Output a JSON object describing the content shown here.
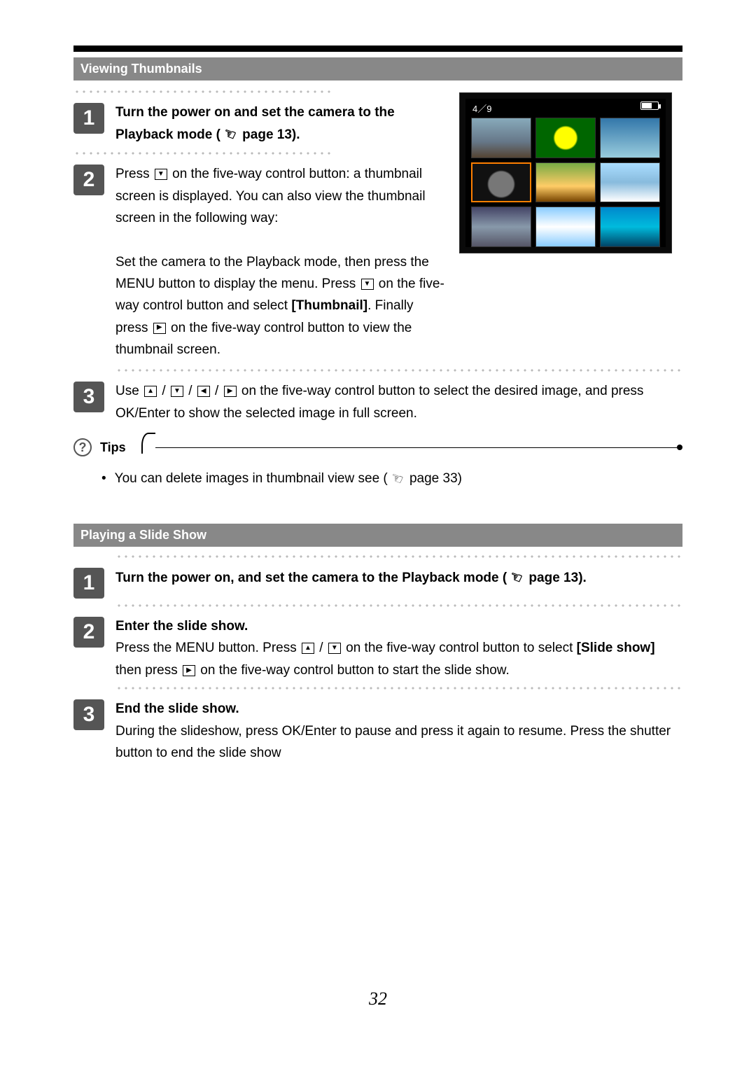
{
  "section1": {
    "title": "Viewing Thumbnails",
    "step1": {
      "num": "1",
      "bold_a": "Turn the power on and set the camera to the Playback mode (",
      "page_ref": "  page 13)."
    },
    "step2": {
      "num": "2",
      "p1_a": "Press ",
      "p1_b": " on the five-way control button: a thumbnail screen is displayed. You can also view the thumbnail screen in the following way:",
      "p2_a": "Set the camera to the Playback mode, then press the MENU button to display the menu. Press ",
      "p2_b": " on the five-way control button and select ",
      "p2_bold": "[Thumbnail]",
      "p2_c": ". Finally press ",
      "p2_d": " on the five-way control button to view the thumbnail screen."
    },
    "step3": {
      "num": "3",
      "a": "Use ",
      "b": " / ",
      "c": " / ",
      "d": " / ",
      "e": " on the five-way control button to select the desired image, and press OK/Enter to show the selected image in full screen."
    }
  },
  "screen": {
    "counter": "4／9"
  },
  "tips": {
    "label": "Tips",
    "bullet_a": "You can delete images in thumbnail view see ",
    "bullet_b": "(",
    "bullet_c": "  page 33)"
  },
  "section2": {
    "title": "Playing a Slide Show",
    "step1": {
      "num": "1",
      "bold_a": "Turn the power on, and set the camera to the Playback mode (",
      "bold_b": "  page 13)."
    },
    "step2": {
      "num": "2",
      "bold": "Enter the slide show.",
      "a": "Press the MENU button. Press ",
      "b": " / ",
      "c": " on the five-way control button to select ",
      "bold2": "[Slide show]",
      "d": " then press ",
      "e": " on the five-way control button to start the slide show."
    },
    "step3": {
      "num": "3",
      "bold": "End the slide show.",
      "body": "During the slideshow, press OK/Enter to pause and press it again to resume. Press the shutter button to end the slide show"
    }
  },
  "pageNumber": "32"
}
